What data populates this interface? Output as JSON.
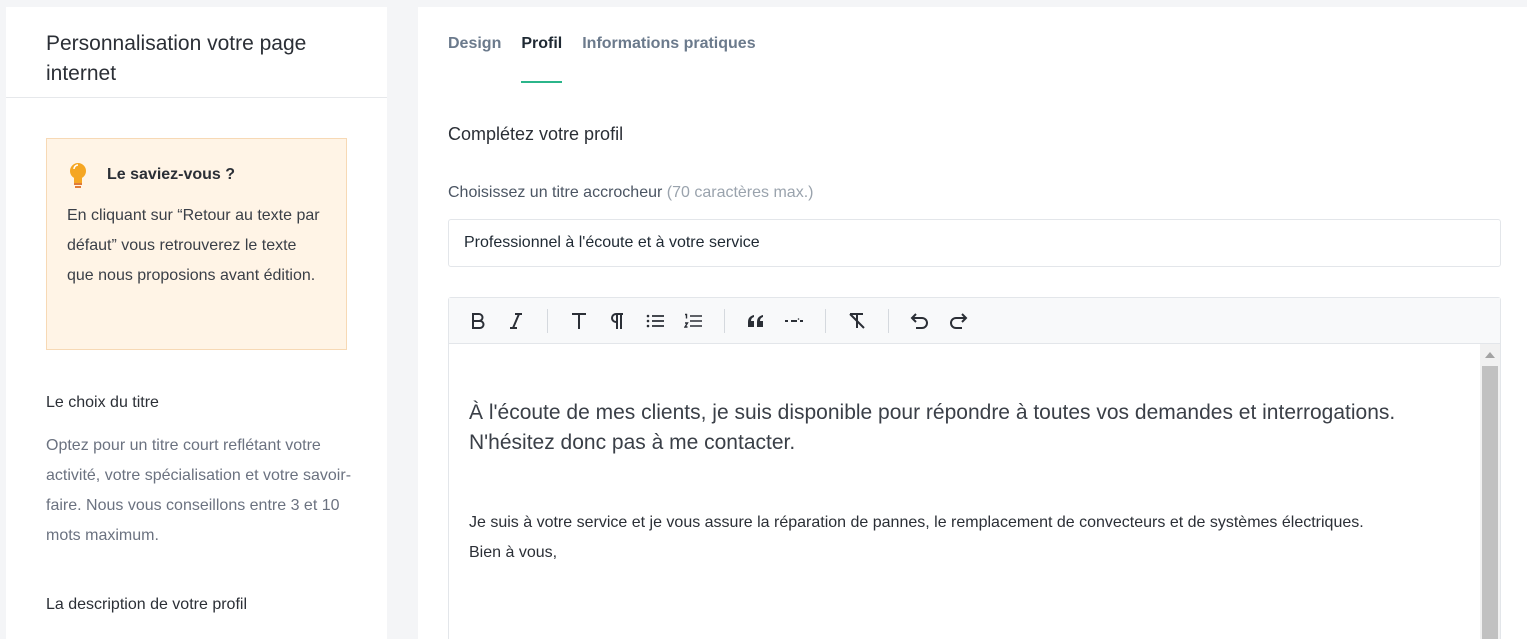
{
  "left": {
    "title": "Personnalisation votre page internet",
    "tip": {
      "icon": "lightbulb-icon",
      "title": "Le saviez-vous ?",
      "text": "En cliquant sur “Retour au texte par défaut” vous retrouverez le texte que nous proposions avant édition."
    },
    "sections": [
      {
        "title": "Le choix du titre",
        "text": "Optez pour un titre court reflétant votre activité, votre spécialisation et votre savoir-faire. Nous vous conseillons entre 3 et 10 mots maximum."
      },
      {
        "title": "La description de votre profil"
      }
    ]
  },
  "right": {
    "tabs": [
      {
        "label": "Design",
        "active": false
      },
      {
        "label": "Profil",
        "active": true
      },
      {
        "label": "Informations pratiques",
        "active": false
      }
    ],
    "form_title": "Complétez votre profil",
    "title_field": {
      "label": "Choisissez un titre accrocheur",
      "hint": "(70 caractères max.)",
      "value": "Professionnel à l'écoute et à votre service"
    },
    "editor": {
      "toolbar": [
        "bold",
        "italic",
        "heading",
        "paragraph",
        "bullet-list",
        "ordered-list",
        "blockquote",
        "horizontal-rule",
        "clear-format",
        "undo",
        "redo"
      ],
      "heading": "À l'écoute de mes clients, je suis disponible pour répondre à toutes vos demandes et interrogations. N'hésitez donc pas à me contacter.",
      "paragraph_line1": "Je suis à votre service et je vous assure la réparation de pannes, le remplacement de convecteurs et de systèmes électriques.",
      "paragraph_line2": "Bien à vous,"
    }
  },
  "colors": {
    "accent": "#2bb58a",
    "tip_background": "#fff4e6",
    "bulb": "#f5a623"
  }
}
